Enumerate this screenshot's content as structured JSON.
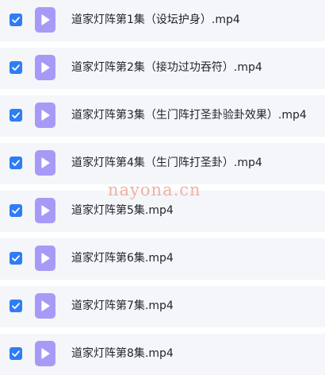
{
  "files": [
    {
      "name": "道家灯阵第1集（设坛护身）.mp4",
      "checked": true
    },
    {
      "name": "道家灯阵第2集（接功过功吞符）.mp4",
      "checked": true
    },
    {
      "name": "道家灯阵第3集（生门阵打圣卦验卦效果）.mp4",
      "checked": true
    },
    {
      "name": "道家灯阵第4集（生门阵打圣卦）.mp4",
      "checked": true
    },
    {
      "name": "道家灯阵第5集.mp4",
      "checked": true
    },
    {
      "name": "道家灯阵第6集.mp4",
      "checked": true
    },
    {
      "name": "道家灯阵第7集.mp4",
      "checked": true
    },
    {
      "name": "道家灯阵第8集.mp4",
      "checked": true
    }
  ],
  "watermark": "nayona.cn",
  "colors": {
    "checkbox": "#2f7df6",
    "file_icon": "#a59bf7",
    "row_background": "#f4f6fa",
    "watermark": "#f0b1a3"
  },
  "icons": {
    "checkbox": "check-icon",
    "file": "video-file-play-icon"
  }
}
